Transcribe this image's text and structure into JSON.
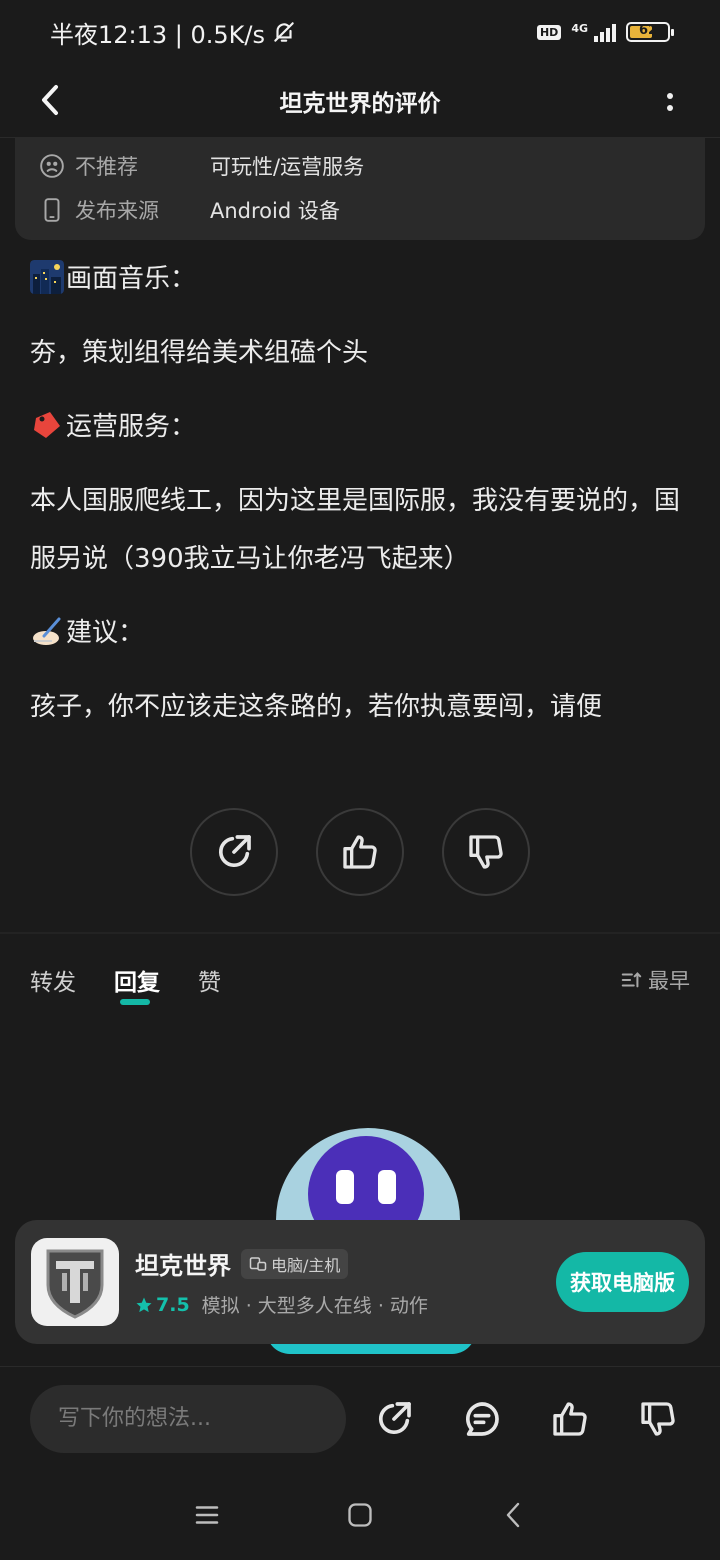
{
  "status_bar": {
    "time_text": "半夜12:13 | 0.5K/s",
    "hd": "HD",
    "network": "4G",
    "battery": "62"
  },
  "header": {
    "title": "坦克世界的评价"
  },
  "info": {
    "rows": [
      {
        "key": "不推荐",
        "value": "可玩性/运营服务",
        "icon": "frown-face-icon"
      },
      {
        "key": "发布来源",
        "value": "Android 设备",
        "icon": "phone-icon"
      }
    ]
  },
  "review": {
    "graphics_heading": "画面音乐：",
    "graphics_text": "夯，策划组得给美术组磕个头",
    "ops_heading": "运营服务：",
    "ops_text": "本人国服爬线工，因为这里是国际服，我没有要说的，国服另说（390我立马让你老冯飞起来）",
    "advice_heading": "建议：",
    "advice_text": "孩子，你不应该走这条路的，若你执意要闯，请便"
  },
  "tabs": {
    "items": [
      "转发",
      "回复",
      "赞"
    ],
    "active": "回复",
    "sort_label": "最早"
  },
  "game_card": {
    "name": "坦克世界",
    "platform": "电脑/主机",
    "rating": "7.5",
    "tags": "模拟 · 大型多人在线 · 动作",
    "button": "获取电脑版"
  },
  "bottom_bar": {
    "placeholder": "写下你的想法..."
  },
  "colors": {
    "accent": "#14b8a6",
    "background": "#1b1b1b",
    "card": "#2a2a2a"
  }
}
